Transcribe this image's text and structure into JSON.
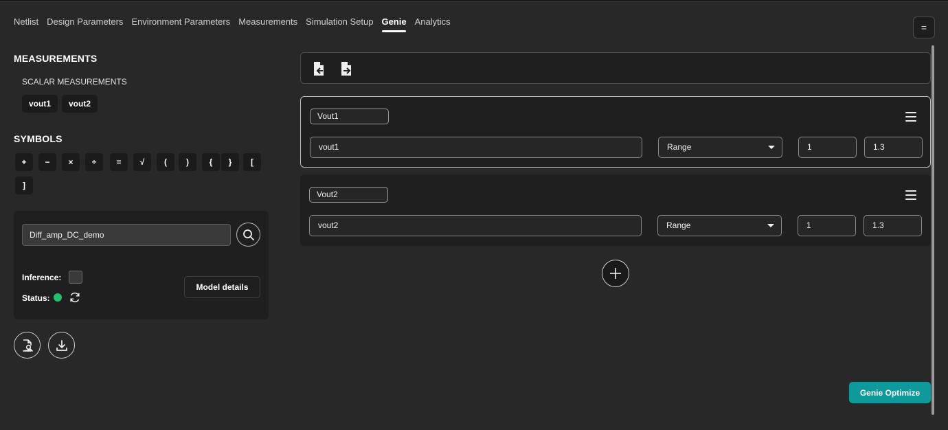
{
  "tabs": [
    {
      "label": "Netlist",
      "active": false
    },
    {
      "label": "Design Parameters",
      "active": false
    },
    {
      "label": "Environment Parameters",
      "active": false
    },
    {
      "label": "Measurements",
      "active": false
    },
    {
      "label": "Simulation Setup",
      "active": false
    },
    {
      "label": "Genie",
      "active": true
    },
    {
      "label": "Analytics",
      "active": false
    }
  ],
  "menu_button": {
    "label": "="
  },
  "measurements_panel": {
    "title": "MEASUREMENTS",
    "subtitle": "SCALAR MEASUREMENTS",
    "chips": [
      "vout1",
      "vout2"
    ]
  },
  "symbols_panel": {
    "title": "SYMBOLS",
    "symbols": [
      "+",
      "−",
      "×",
      "÷",
      "=",
      "√",
      "(",
      ")",
      "{",
      "}",
      "[",
      "]"
    ]
  },
  "model": {
    "name_value": "Diff_amp_DC_demo",
    "inference_label": "Inference:",
    "status_label": "Status:",
    "status_color": "#1fc26b",
    "details_button": "Model details"
  },
  "measures": [
    {
      "name": "Vout1",
      "expression": "vout1",
      "mode": "Range",
      "min": "1",
      "max": "1.3",
      "selected": true
    },
    {
      "name": "Vout2",
      "expression": "vout2",
      "mode": "Range",
      "min": "1",
      "max": "1.3",
      "selected": false
    }
  ],
  "actions": {
    "genie_optimize": "Genie Optimize",
    "accent_color": "#0e9a9a"
  },
  "icons": {
    "search": "search-icon",
    "refresh": "refresh-icon",
    "file_search": "file-search-icon",
    "download": "download-icon",
    "import": "file-import-icon",
    "export": "file-export-icon",
    "add": "plus-icon",
    "menu": "hamburger-icon"
  }
}
